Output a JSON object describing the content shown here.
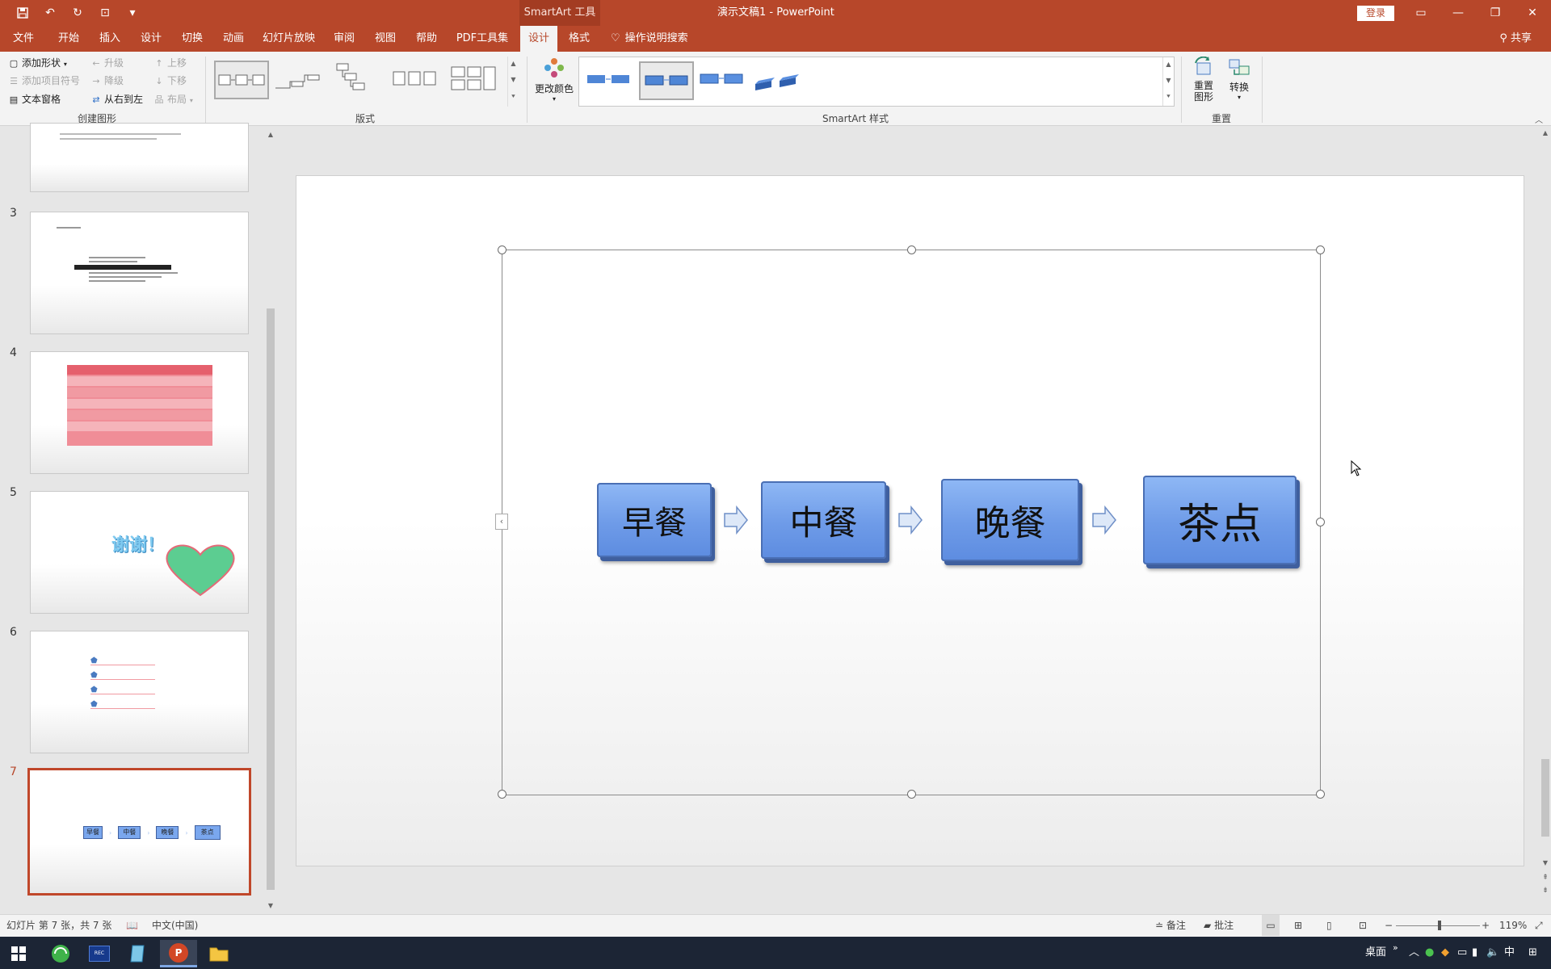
{
  "title_bar": {
    "context_tool": "SmartArt 工具",
    "doc_title": "演示文稿1  -  PowerPoint",
    "login_label": "登录"
  },
  "tabs": [
    {
      "label": "文件"
    },
    {
      "label": "开始"
    },
    {
      "label": "插入"
    },
    {
      "label": "设计"
    },
    {
      "label": "切换"
    },
    {
      "label": "动画"
    },
    {
      "label": "幻灯片放映"
    },
    {
      "label": "审阅"
    },
    {
      "label": "视图"
    },
    {
      "label": "帮助"
    },
    {
      "label": "PDF工具集"
    },
    {
      "label": "设计"
    },
    {
      "label": "格式"
    },
    {
      "label": "操作说明搜索"
    }
  ],
  "share_label": "共享",
  "ribbon": {
    "create_graphic": {
      "add_shape": "添加形状",
      "add_bullet": "添加项目符号",
      "text_pane": "文本窗格",
      "promote": "升级",
      "demote": "降级",
      "right_to_left": "从右到左",
      "move_up": "上移",
      "move_down": "下移",
      "layout": "布局",
      "group_label": "创建图形"
    },
    "layouts_label": "版式",
    "change_colors": "更改颜色",
    "styles_label": "SmartArt 样式",
    "reset_graphic": "重置\n图形",
    "convert": "转换",
    "reset_label": "重置"
  },
  "slides": [
    {
      "number": "3"
    },
    {
      "number": "4"
    },
    {
      "number": "5"
    },
    {
      "number": "6"
    },
    {
      "number": "7"
    }
  ],
  "thumb_texts": {
    "s5_text": "谢谢！",
    "s7_items": [
      "早餐",
      "中餐",
      "晚餐",
      "茶点"
    ]
  },
  "smartart": {
    "items": [
      "早餐",
      "中餐",
      "晚餐",
      "茶点"
    ]
  },
  "status": {
    "slide_info": "幻灯片 第 7 张，共 7 张",
    "language": "中文(中国)",
    "notes": "备注",
    "comments": "批注",
    "zoom": "119%"
  },
  "taskbar": {
    "desktop_label": "桌面",
    "ime": "中"
  }
}
